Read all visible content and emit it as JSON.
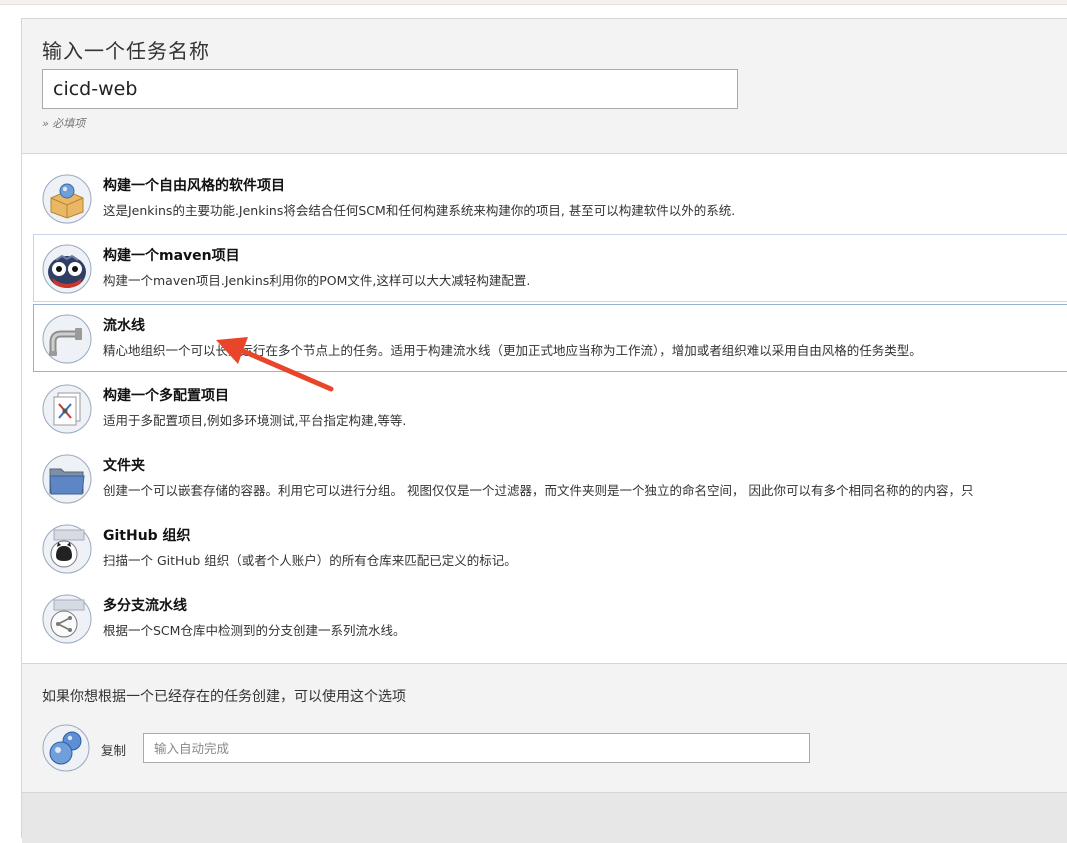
{
  "header": {
    "title": "输入一个任务名称",
    "item_name_value": "cicd-web",
    "required_note": "» 必填项"
  },
  "item_types": [
    {
      "label": "构建一个自由风格的软件项目",
      "description": "这是Jenkins的主要功能.Jenkins将会结合任何SCM和任何构建系统来构建你的项目, 甚至可以构建软件以外的系统.",
      "icon": "freestyle-project-icon"
    },
    {
      "label": "构建一个maven项目",
      "description": "构建一个maven项目.Jenkins利用你的POM文件,这样可以大大减轻构建配置.",
      "icon": "maven-project-icon"
    },
    {
      "label": "流水线",
      "description": "精心地组织一个可以长期运行在多个节点上的任务。适用于构建流水线（更加正式地应当称为工作流），增加或者组织难以采用自由风格的任务类型。",
      "icon": "pipeline-icon"
    },
    {
      "label": "构建一个多配置项目",
      "description": "适用于多配置项目,例如多环境测试,平台指定构建,等等.",
      "icon": "multi-config-project-icon"
    },
    {
      "label": "文件夹",
      "description": "创建一个可以嵌套存储的容器。利用它可以进行分组。 视图仅仅是一个过滤器，而文件夹则是一个独立的命名空间， 因此你可以有多个相同名称的的内容，只",
      "icon": "folder-icon"
    },
    {
      "label": "GitHub 组织",
      "description": "扫描一个 GitHub 组织（或者个人账户）的所有仓库来匹配已定义的标记。",
      "icon": "github-organization-icon"
    },
    {
      "label": "多分支流水线",
      "description": "根据一个SCM仓库中检测到的分支创建一系列流水线。",
      "icon": "multibranch-pipeline-icon"
    }
  ],
  "copy": {
    "hint": "如果你想根据一个已经存在的任务创建，可以使用这个选项",
    "label": "复制",
    "placeholder": "输入自动完成",
    "icon": "copy-from-icon"
  },
  "colors": {
    "arrow": "#e8452b",
    "panel_bg": "#f3f3f3",
    "selected_border": "#99b1d3"
  }
}
